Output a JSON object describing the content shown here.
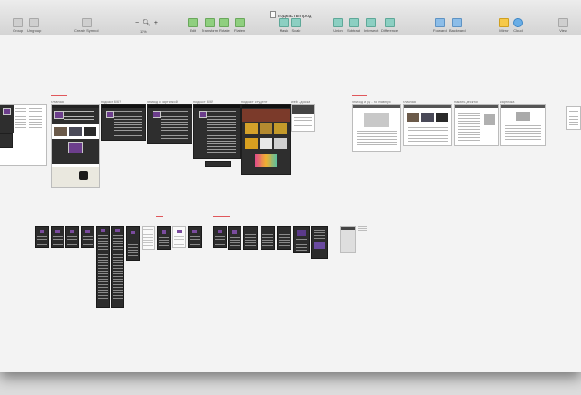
{
  "window": {
    "title": "подкасты прод"
  },
  "toolbar": {
    "group": "Group",
    "ungroup": "Ungroup",
    "create_symbol": "Create Symbol",
    "zoom_minus": "−",
    "zoom_plus": "+",
    "zoom": "11%",
    "edit": "Edit",
    "transform": "Transform",
    "rotate": "Rotate",
    "flatten": "Flatten",
    "mask": "Mask",
    "scale": "Scale",
    "union": "Union",
    "subtract": "Subtract",
    "intersect": "Intersect",
    "difference": "Difference",
    "forward": "Forward",
    "backward": "Backward",
    "mirror": "Mirror",
    "cloud": "Cloud",
    "view": "View"
  },
  "artboards": {
    "labels": [
      "главная",
      "подкаст 6/6?",
      "эпизод с картинкой",
      "подкаст 6/6?",
      "подкаст студент",
      "web - доска",
      "эпизод и ру - го главную",
      "главная",
      "нажать десктоп",
      "карточка"
    ]
  },
  "colors": {
    "accent": "#6c3e8c",
    "note": "#e0575b"
  }
}
